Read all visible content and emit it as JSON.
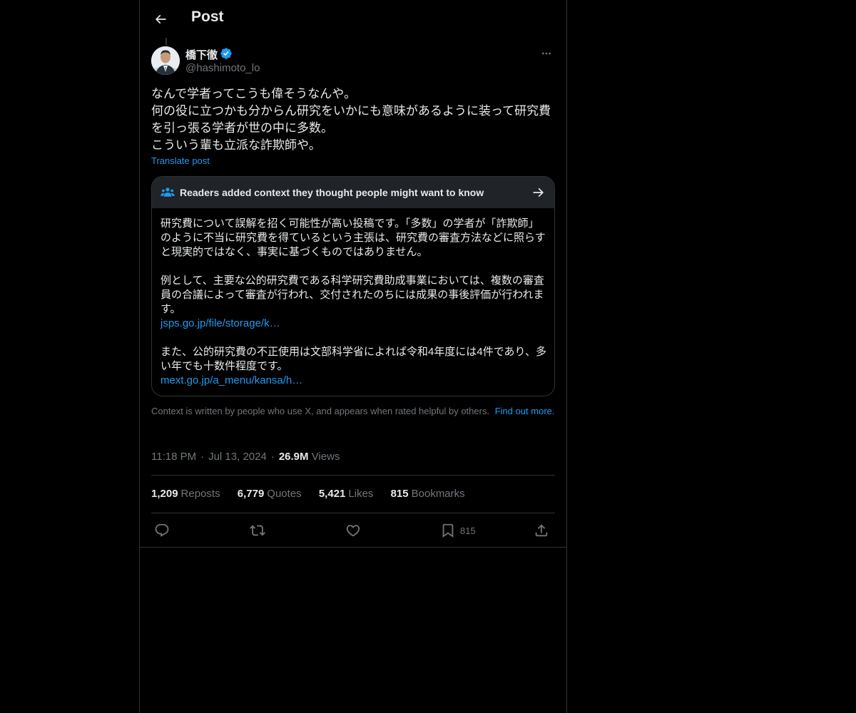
{
  "header": {
    "title": "Post"
  },
  "author": {
    "display_name": "橋下徹",
    "handle": "@hashimoto_lo",
    "verified_color": "#1d9bf0"
  },
  "post": {
    "text": "なんで学者ってこうも偉そうなんや。\n何の役に立つかも分からん研究をいかにも意味があるように装って研究費を引っ張る学者が世の中に多数。\nこういう輩も立派な詐欺師や。",
    "translate_label": "Translate post"
  },
  "community_note": {
    "title": "Readers added context they thought people might want to know",
    "paragraph1": "研究費について誤解を招く可能性が高い投稿です。「多数」の学者が「詐欺師」のように不当に研究費を得ているという主張は、研究費の審査方法などに照らすと現実的ではなく、事実に基づくものではありません。",
    "paragraph2": "例として、主要な公的研究費である科学研究費助成事業においては、複数の審査員の合議によって審査が行われ、交付されたのちには成果の事後評価が行われます。",
    "link1": "jsps.go.jp/file/storage/k…",
    "paragraph3": "また、公的研究費の不正使用は文部科学省によれば令和4年度には4件であり、多い年でも十数件程度です。",
    "link2": "mext.go.jp/a_menu/kansa/h…"
  },
  "context_info": {
    "text": "Context is written by people who use X, and appears when rated helpful by others.",
    "link": "Find out more."
  },
  "meta": {
    "time": "11:18 PM",
    "date": "Jul 13, 2024",
    "views_count": "26.9M",
    "views_label": "Views"
  },
  "stats": [
    {
      "count": "1,209",
      "label": "Reposts"
    },
    {
      "count": "6,779",
      "label": "Quotes"
    },
    {
      "count": "5,421",
      "label": "Likes"
    },
    {
      "count": "815",
      "label": "Bookmarks"
    }
  ],
  "actions": {
    "reply_icon": "reply-icon",
    "repost_icon": "repost-icon",
    "like_icon": "heart-icon",
    "bookmark_icon": "bookmark-icon",
    "bookmark_count": "815",
    "share_icon": "share-icon"
  },
  "colors": {
    "background": "#000000",
    "text": "#e7e9ea",
    "secondary": "#71767b",
    "accent": "#1d9bf0",
    "border": "#2f3336"
  }
}
